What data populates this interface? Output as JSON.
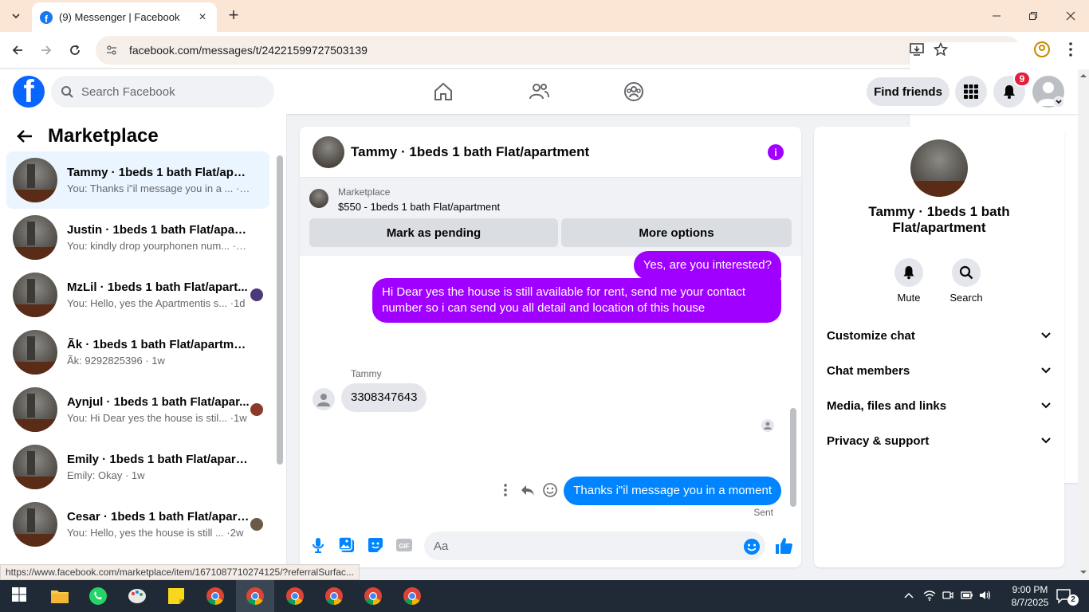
{
  "browser": {
    "tab_title": "(9) Messenger | Facebook",
    "url": "facebook.com/messages/t/24221599727503139",
    "status_url": "https://www.facebook.com/marketplace/item/1671087710274125/?referralSurfac..."
  },
  "fb_header": {
    "search_placeholder": "Search Facebook",
    "find_friends": "Find friends",
    "notification_count": "9"
  },
  "left_panel": {
    "title": "Marketplace",
    "conversations": [
      {
        "name": "Tammy · 1beds 1 bath Flat/apart...",
        "snippet": "You: Thanks i\"il message you in a ... ·1m"
      },
      {
        "name": "Justin · 1beds 1 bath Flat/apartm...",
        "snippet": "You: kindly drop yourphonen num... ·1m"
      },
      {
        "name": "MzLil · 1beds 1 bath Flat/apart...",
        "snippet": "You: Hello, yes the Apartmentis s... ·1d"
      },
      {
        "name": "Ãk · 1beds 1 bath Flat/apartment",
        "snippet": "Ãk: 9292825396 · 1w"
      },
      {
        "name": "Aynjul · 1beds 1 bath Flat/apar...",
        "snippet": "You: Hi Dear yes the house is stil... ·1w"
      },
      {
        "name": "Emily · 1beds 1 bath Flat/apartm...",
        "snippet": "Emily: Okay · 1w"
      },
      {
        "name": "Cesar · 1beds 1 bath Flat/apart...",
        "snippet": "You: Hello, yes the house is still ... ·2w"
      }
    ]
  },
  "chat": {
    "title": "Tammy · 1beds 1 bath Flat/apartment",
    "marketplace_label": "Marketplace",
    "listing": "$550 - 1beds 1 bath Flat/apartment",
    "mark_pending": "Mark as pending",
    "more_options": "More options",
    "msg_1": "Yes, are you interested?",
    "msg_2": "Hi Dear yes the house is still available for rent, send me your contact number so i can send you all detail and location of this house",
    "sender_name": "Tammy",
    "msg_3": "3308347643",
    "msg_4": "Thanks i\"il message you in a moment",
    "sent_status": "Sent",
    "composer_placeholder": "Aa"
  },
  "right_panel": {
    "name": "Tammy · 1beds 1 bath Flat/apartment",
    "mute": "Mute",
    "search": "Search",
    "sections": [
      "Customize chat",
      "Chat members",
      "Media, files and links",
      "Privacy & support"
    ]
  },
  "taskbar": {
    "time": "9:00 PM",
    "date": "8/7/2025",
    "notif_count": "2"
  },
  "colors": {
    "fb_blue": "#0866ff",
    "purple_bubble": "#a000ff",
    "blue_bubble": "#0084ff"
  }
}
